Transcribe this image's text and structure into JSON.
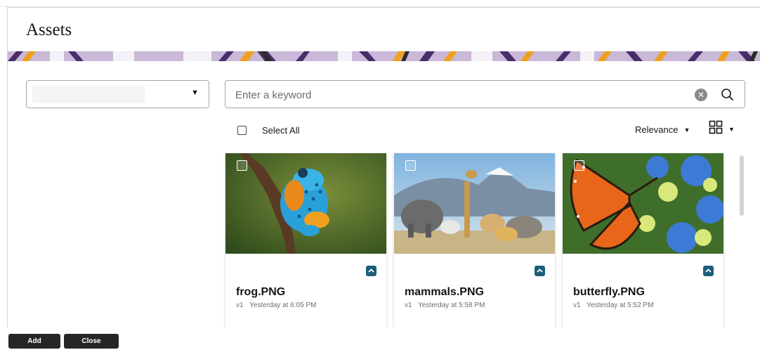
{
  "dialog": {
    "title": "Assets"
  },
  "folder_select": {
    "value": ""
  },
  "search": {
    "placeholder": "Enter a keyword",
    "value": ""
  },
  "toolbar": {
    "select_all_label": "Select All",
    "sort_label": "Relevance",
    "view_icon": "grid-view-icon"
  },
  "assets": [
    {
      "name": "frog.PNG",
      "version": "v1",
      "modified": "Yesterday at 6:05 PM",
      "thumbnail": "frog-photo"
    },
    {
      "name": "mammals.PNG",
      "version": "v1",
      "modified": "Yesterday at 5:58 PM",
      "thumbnail": "mammals-photo"
    },
    {
      "name": "butterfly.PNG",
      "version": "v1",
      "modified": "Yesterday at 5:52 PM",
      "thumbnail": "butterfly-photo"
    }
  ],
  "footer": {
    "add_label": "Add",
    "close_label": "Close"
  },
  "colors": {
    "expand_button": "#1b5e7a",
    "footer_button": "#262626",
    "banner_purple": "#c7b5d6",
    "banner_orange": "#f0a020"
  }
}
